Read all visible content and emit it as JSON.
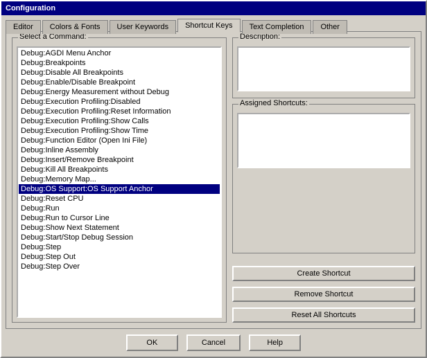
{
  "window": {
    "title": "Configuration"
  },
  "tabs": [
    {
      "id": "editor",
      "label": "Editor",
      "active": false
    },
    {
      "id": "colors-fonts",
      "label": "Colors & Fonts",
      "active": false
    },
    {
      "id": "user-keywords",
      "label": "User Keywords",
      "active": false
    },
    {
      "id": "shortcut-keys",
      "label": "Shortcut Keys",
      "active": true
    },
    {
      "id": "text-completion",
      "label": "Text Completion",
      "active": false
    },
    {
      "id": "other",
      "label": "Other",
      "active": false
    }
  ],
  "left_panel": {
    "group_label": "Select a Command:",
    "commands": [
      "Debug:AGDI Menu Anchor",
      "Debug:Breakpoints",
      "Debug:Disable All Breakpoints",
      "Debug:Enable/Disable Breakpoint",
      "Debug:Energy Measurement without Debug",
      "Debug:Execution Profiling:Disabled",
      "Debug:Execution Profiling:Reset Information",
      "Debug:Execution Profiling:Show Calls",
      "Debug:Execution Profiling:Show Time",
      "Debug:Function Editor (Open Ini File)",
      "Debug:Inline Assembly",
      "Debug:Insert/Remove Breakpoint",
      "Debug:Kill All Breakpoints",
      "Debug:Memory Map...",
      "Debug:OS Support:OS Support Anchor",
      "Debug:Reset CPU",
      "Debug:Run",
      "Debug:Run to Cursor Line",
      "Debug:Show Next Statement",
      "Debug:Start/Stop Debug Session",
      "Debug:Step",
      "Debug:Step Out",
      "Debug:Step Over"
    ],
    "selected_index": 14
  },
  "right_panel": {
    "description_label": "Description:",
    "description_value": "",
    "shortcuts_label": "Assigned Shortcuts:",
    "shortcuts_value": ""
  },
  "buttons": {
    "create_shortcut": "Create Shortcut",
    "remove_shortcut": "Remove Shortcut",
    "reset_shortcuts": "Reset All Shortcuts"
  },
  "bottom_buttons": {
    "ok": "OK",
    "cancel": "Cancel",
    "help": "Help"
  }
}
